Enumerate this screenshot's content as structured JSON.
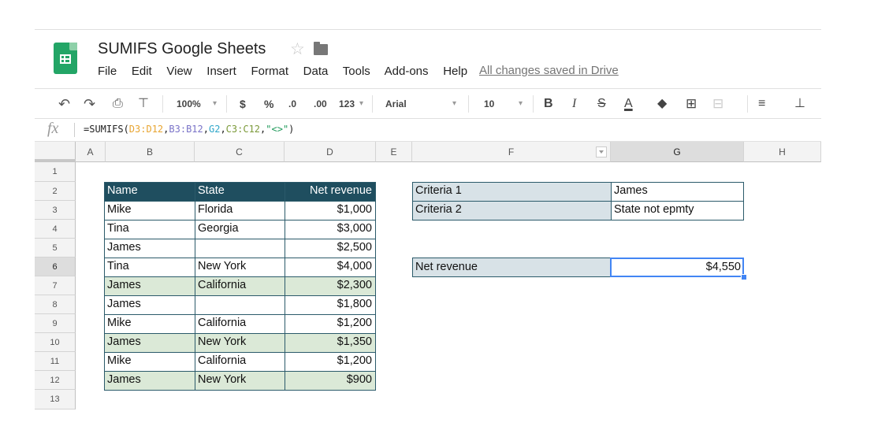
{
  "app": {
    "title": "SUMIFS Google Sheets",
    "menu": [
      "File",
      "Edit",
      "View",
      "Insert",
      "Format",
      "Data",
      "Tools",
      "Add-ons",
      "Help"
    ],
    "save_status": "All changes saved in Drive"
  },
  "toolbar": {
    "zoom": "100%",
    "currency": "$",
    "percent": "%",
    "dec_decrease": ".0",
    "dec_increase": ".00",
    "number_format": "123",
    "font": "Arial",
    "font_size": "10",
    "bold": "B",
    "italic": "I",
    "strike": "S",
    "text_color": "A"
  },
  "formula_bar": {
    "fx": "fx",
    "parts": [
      "=SUMIFS(",
      "D3:D12",
      ",",
      "B3:B12",
      ",",
      "G2",
      ",",
      "C3:C12",
      ",",
      "\"<>\"",
      ")"
    ]
  },
  "columns": [
    "A",
    "B",
    "C",
    "D",
    "E",
    "F",
    "G",
    "H"
  ],
  "rows": [
    "1",
    "2",
    "3",
    "4",
    "5",
    "6",
    "7",
    "8",
    "9",
    "10",
    "11",
    "12",
    "13"
  ],
  "table": {
    "headers": [
      "Name",
      "State",
      "Net revenue"
    ],
    "rows": [
      [
        "Mike",
        "Florida",
        "$1,000"
      ],
      [
        "Tina",
        "Georgia",
        "$3,000"
      ],
      [
        "James",
        "",
        "$2,500"
      ],
      [
        "Tina",
        "New York",
        "$4,000"
      ],
      [
        "James",
        "California",
        "$2,300"
      ],
      [
        "James",
        "",
        "$1,800"
      ],
      [
        "Mike",
        "California",
        "$1,200"
      ],
      [
        "James",
        "New York",
        "$1,350"
      ],
      [
        "Mike",
        "California",
        "$1,200"
      ],
      [
        "James",
        "New York",
        "$900"
      ]
    ]
  },
  "criteria": [
    {
      "label": "Criteria 1",
      "value": "James"
    },
    {
      "label": "Criteria 2",
      "value": "State not epmty"
    }
  ],
  "result": {
    "label": "Net revenue",
    "value": "$4,550"
  },
  "colors": {
    "header_bg": "#1f4e5f",
    "highlight_row": "#dbe9d7",
    "criteria_bg": "#d8e2e7",
    "selection": "#4285f4",
    "logo": "#23a566"
  }
}
